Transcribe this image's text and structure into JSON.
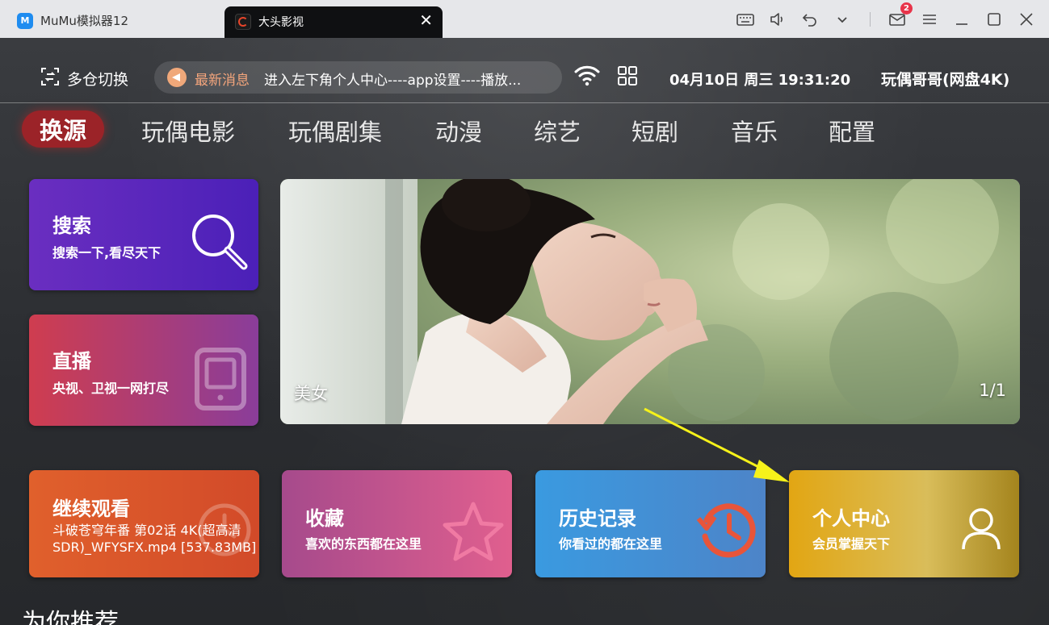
{
  "emulator": {
    "app_title": "MuMu模拟器12",
    "app_logo_text": "M",
    "tab_title": "大头影视",
    "tab_close": "✕",
    "message_count": "2",
    "controls": [
      "keyboard-icon",
      "volume-icon",
      "back-icon",
      "chevron-down-icon",
      "mail-icon",
      "menu-icon",
      "minimize-icon",
      "maximize-icon",
      "close-icon"
    ]
  },
  "status": {
    "switch_label": "多仓切换",
    "news_tag": "最新消息",
    "news_text": "进入左下角个人中心----app设置----播放...",
    "clock": "04月10日 周三 19:31:20",
    "user_name": "玩偶哥哥(网盘4K)"
  },
  "nav": {
    "items": [
      "换源",
      "玩偶电影",
      "玩偶剧集",
      "动漫",
      "综艺",
      "短剧",
      "音乐",
      "配置"
    ],
    "active_index": 0
  },
  "tiles": {
    "search": {
      "title": "搜索",
      "subtitle": "搜索一下,看尽天下"
    },
    "live": {
      "title": "直播",
      "subtitle": "央视、卫视一网打尽"
    },
    "continue": {
      "title": "继续观看",
      "file": "斗破苍穹年番 第02话 4K(超高清SDR)_WFYSFX.mp4 [537.83MB]"
    },
    "favorites": {
      "title": "收藏",
      "subtitle": "喜欢的东西都在这里"
    },
    "history": {
      "title": "历史记录",
      "subtitle": "你看过的都在这里"
    },
    "profile": {
      "title": "个人中心",
      "subtitle": "会员掌握天下"
    }
  },
  "banner": {
    "label": "美女",
    "pager": "1/1"
  },
  "section_title": "为你推荐",
  "colors": {
    "accent_red": "#9b2328",
    "news_orange": "#f4a57c",
    "annotation_arrow": "#f6f21a"
  }
}
